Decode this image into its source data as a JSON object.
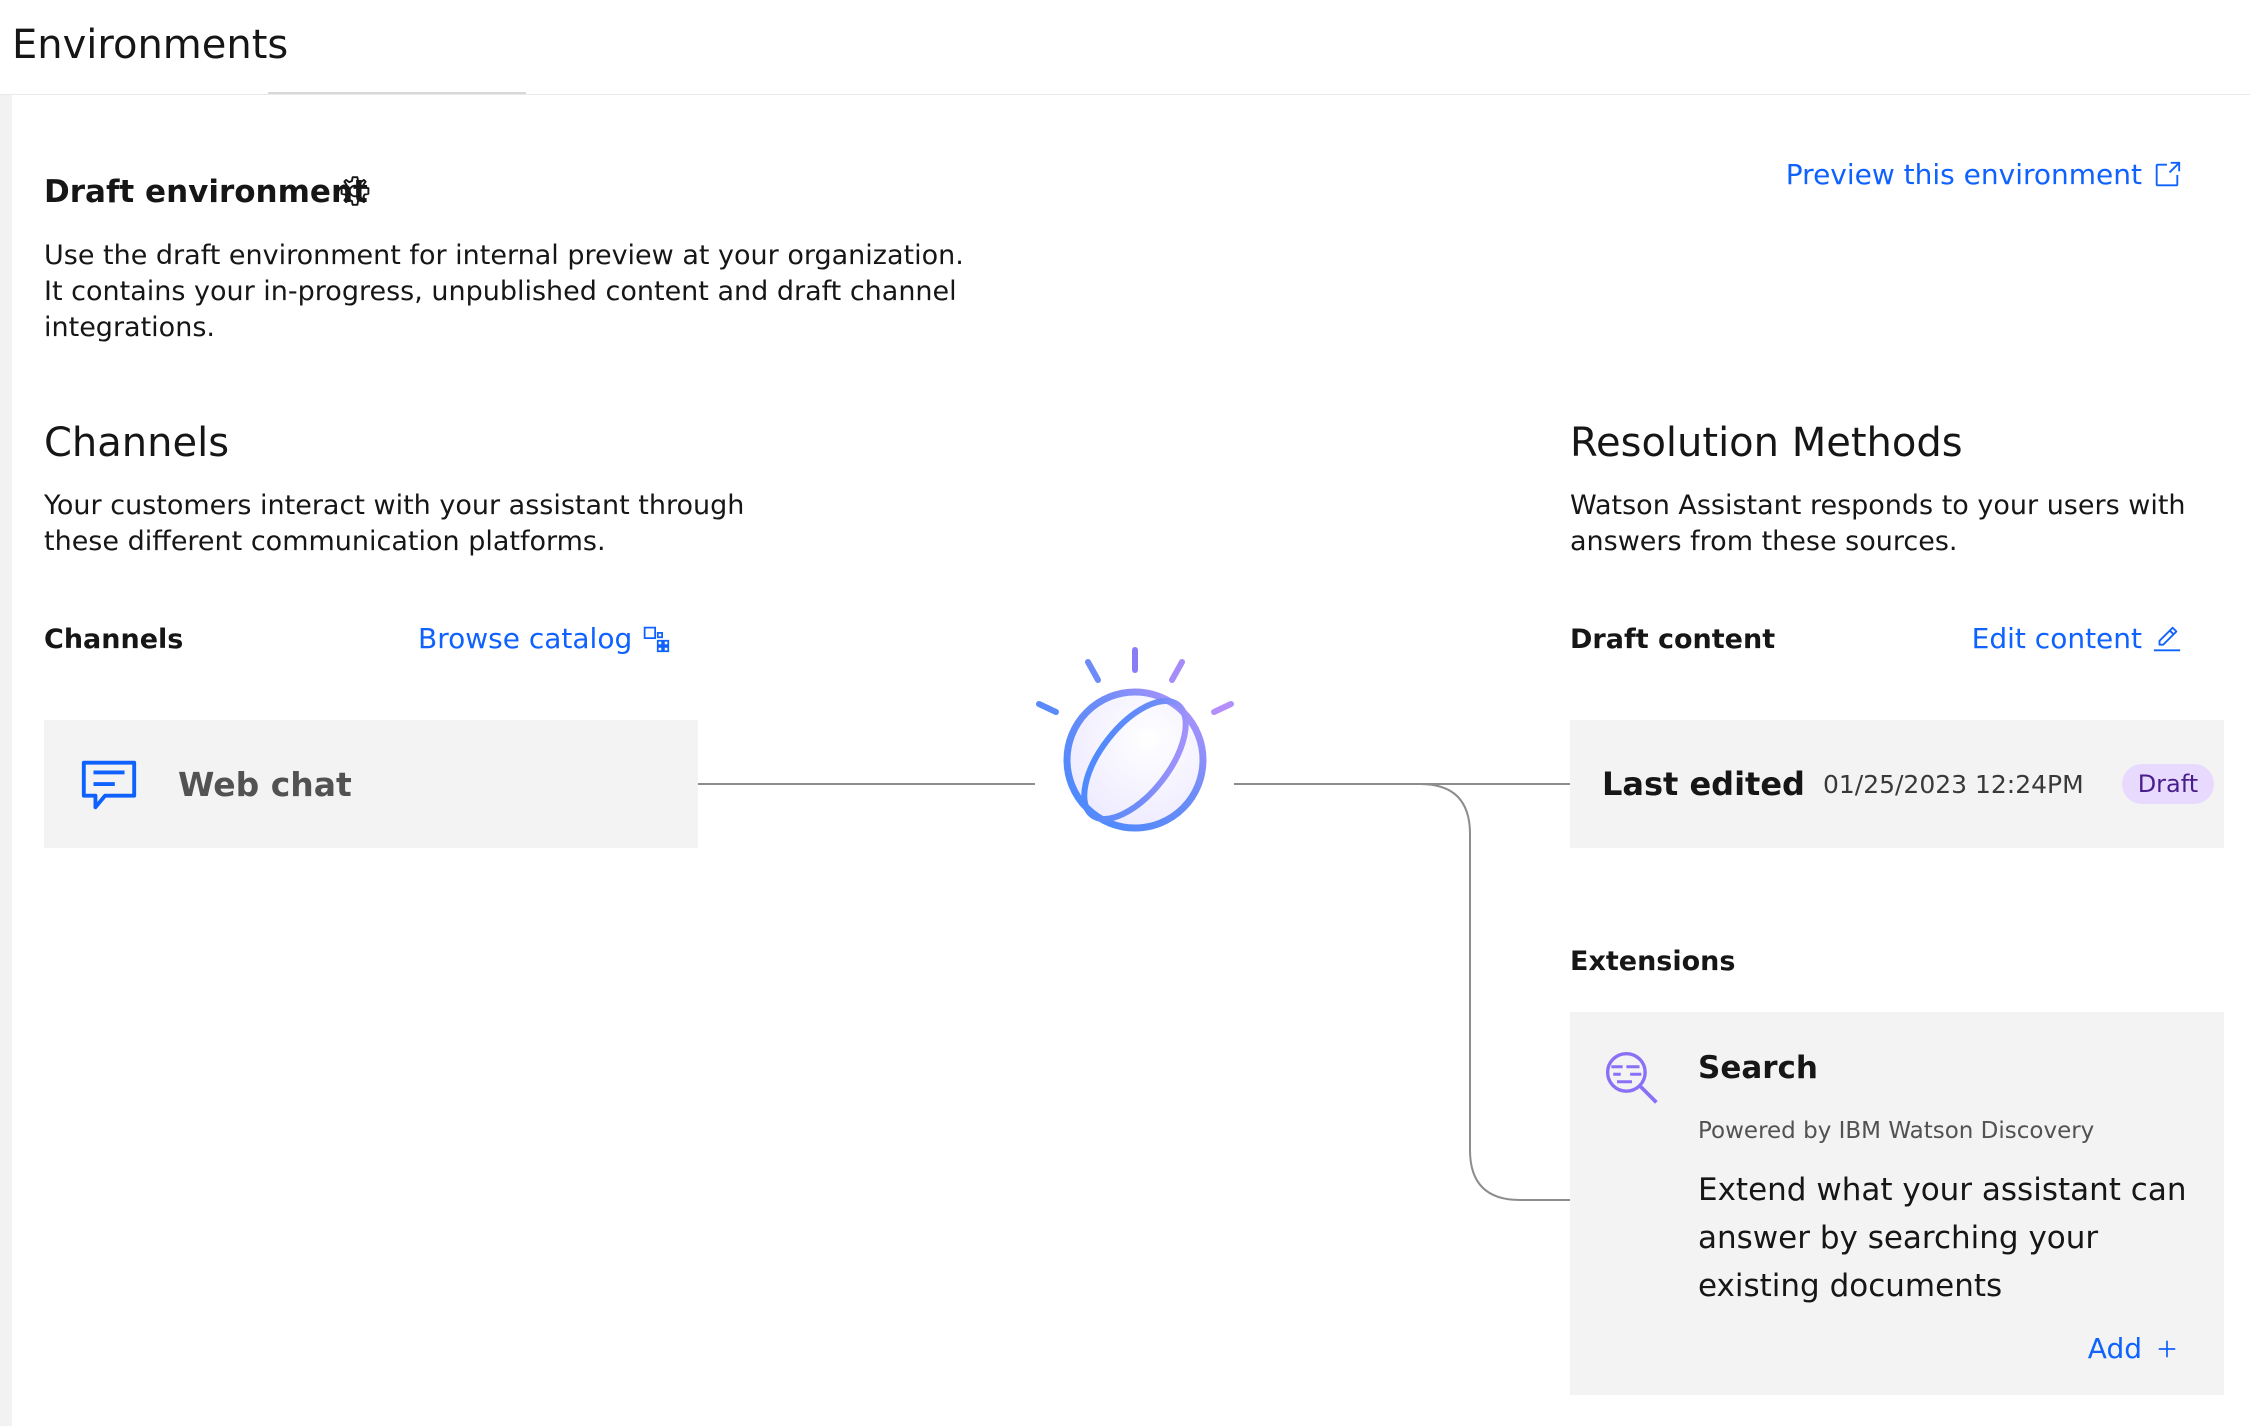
{
  "header": {
    "title": "Environments"
  },
  "draft": {
    "title": "Draft environment",
    "settings_icon": "gear-icon",
    "description": "Use the draft environment for internal preview at your organization. It contains your in-progress, unpublished content and draft channel integrations.",
    "preview_link": "Preview this environment",
    "preview_icon": "launch-icon"
  },
  "channels": {
    "heading": "Channels",
    "description": "Your customers interact with your assistant through these different communication platforms.",
    "subheading": "Channels",
    "browse_link": "Browse catalog",
    "browse_icon": "catalog-icon",
    "items": [
      {
        "label": "Web chat",
        "icon": "chat-icon"
      }
    ]
  },
  "center": {
    "icon": "watson-logo-icon"
  },
  "resolution": {
    "heading": "Resolution Methods",
    "description": "Watson Assistant responds to your users with answers from these sources.",
    "draft_content": {
      "subheading": "Draft content",
      "edit_link": "Edit content",
      "edit_icon": "edit-icon",
      "last_edited_label": "Last edited",
      "last_edited_value": "01/25/2023 12:24PM",
      "tag": "Draft"
    },
    "extensions": {
      "subheading": "Extensions",
      "items": [
        {
          "title": "Search",
          "icon": "search-discovery-icon",
          "powered_by": "Powered by IBM Watson Discovery",
          "description": "Extend what your assistant can answer by searching your existing documents",
          "add_label": "Add",
          "add_icon": "plus-icon"
        }
      ]
    }
  },
  "colors": {
    "link": "#0f62fe",
    "tile_bg": "#f3f3f3",
    "tag_bg": "#e8daff",
    "tag_text": "#491d8b",
    "connector": "#8d8d8d"
  }
}
